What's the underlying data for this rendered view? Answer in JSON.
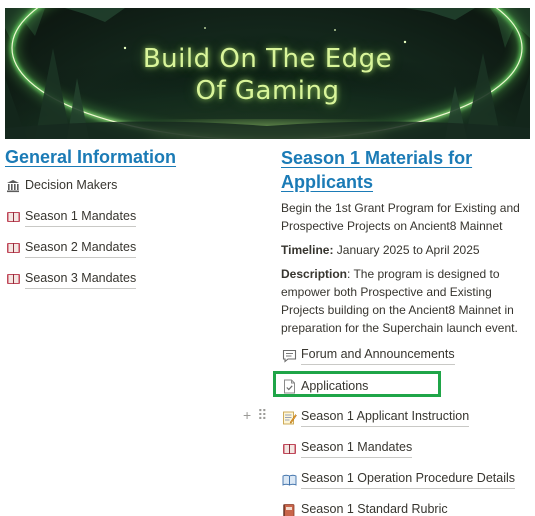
{
  "banner": {
    "title_line1": "Build On The Edge",
    "title_line2": "Of Gaming"
  },
  "left": {
    "heading": "General Information",
    "items": [
      {
        "label": "Decision Makers",
        "icon": "bank-icon"
      },
      {
        "label": "Season 1 Mandates",
        "icon": "book-icon"
      },
      {
        "label": "Season 2 Mandates",
        "icon": "book-icon"
      },
      {
        "label": "Season 3 Mandates",
        "icon": "book-icon"
      }
    ]
  },
  "right": {
    "heading_line1": "Season 1 Materials for",
    "heading_line2": "Applicants",
    "intro": "Begin the 1st Grant Program for Existing and Prospective Projects on Ancient8 Mainnet",
    "timeline_label": "Timeline:",
    "timeline_value": " January 2025 to April 2025",
    "description_label": "Description",
    "description_value": ": The program is designed to empower both Prospective and Existing Projects building on the Ancient8 Mainnet in preparation for the Superchain launch event.",
    "links": [
      {
        "label": "Forum and Announcements",
        "icon": "speech-bubble-icon"
      },
      {
        "label": "Applications",
        "icon": "document-check-icon"
      },
      {
        "label": "Season 1 Applicant Instruction",
        "icon": "memo-icon"
      },
      {
        "label": "Season 1 Mandates",
        "icon": "book-icon"
      },
      {
        "label": "Season 1 Operation Procedure Details",
        "icon": "open-book-icon"
      },
      {
        "label": "Season 1 Standard Rubric",
        "icon": "notebook-icon"
      }
    ],
    "block_handles": {
      "add": "+",
      "drag": "⠿"
    }
  },
  "colors": {
    "heading": "#1b7bb6",
    "highlight_box": "#1fa548",
    "banner_glow": "#d9f59a"
  }
}
